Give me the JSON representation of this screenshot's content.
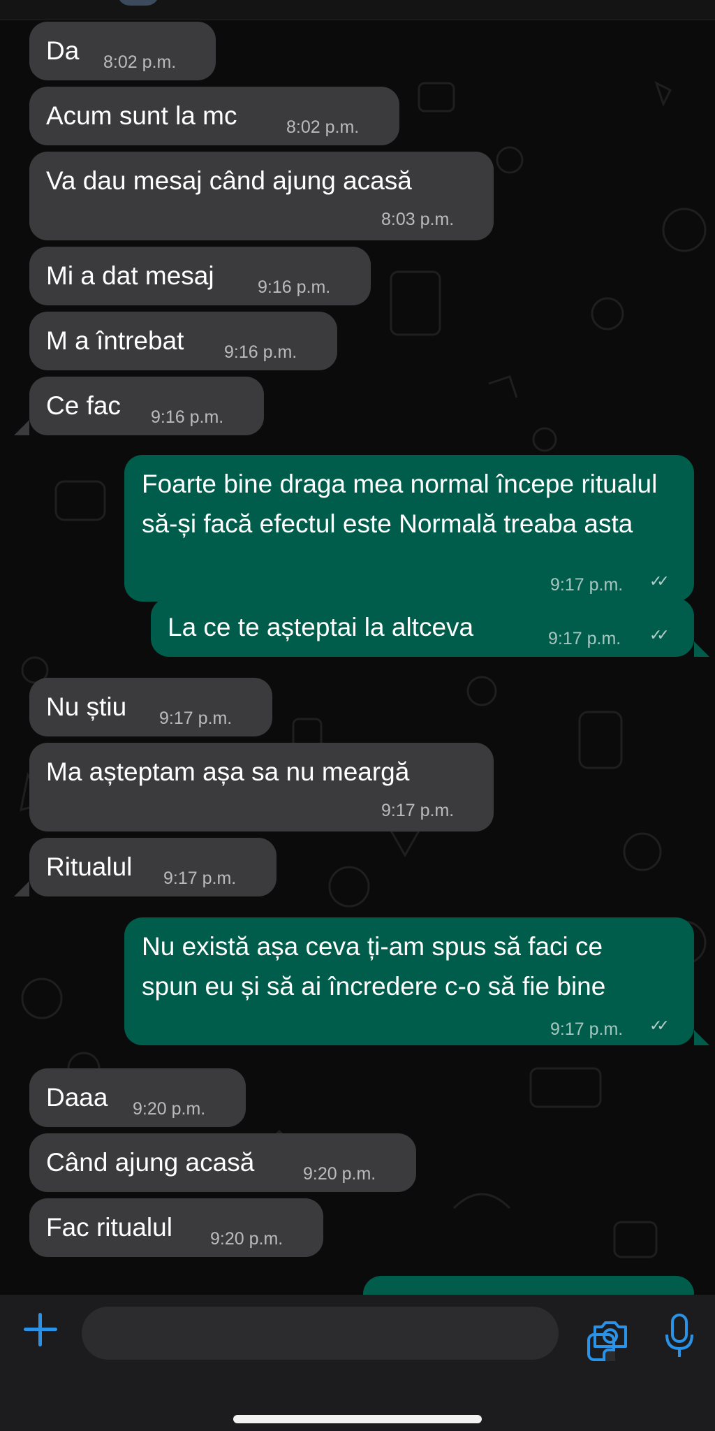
{
  "messages": [
    {
      "dir": "in",
      "text": "Da",
      "time": "8:02 p.m."
    },
    {
      "dir": "in",
      "text": "Acum sunt la mc",
      "time": "8:02 p.m."
    },
    {
      "dir": "in",
      "text": "Va dau mesaj când ajung acasă",
      "time": "8:03 p.m."
    },
    {
      "dir": "in",
      "text": "Mi a dat mesaj",
      "time": "9:16 p.m."
    },
    {
      "dir": "in",
      "text": "M a întrebat",
      "time": "9:16 p.m."
    },
    {
      "dir": "in",
      "text": "Ce fac",
      "time": "9:16 p.m."
    },
    {
      "dir": "out",
      "text": "Foarte bine draga mea normal începe ritualul să-și facă efectul este Normală treaba asta",
      "time": "9:17 p.m.",
      "status": "read"
    },
    {
      "dir": "out",
      "text": "La ce te așteptai la altceva",
      "time": "9:17 p.m.",
      "status": "read"
    },
    {
      "dir": "in",
      "text": "Nu știu",
      "time": "9:17 p.m."
    },
    {
      "dir": "in",
      "text": "Ma așteptam așa sa nu meargă",
      "time": "9:17 p.m."
    },
    {
      "dir": "in",
      "text": "Ritualul",
      "time": "9:17 p.m."
    },
    {
      "dir": "out",
      "text": "Nu există așa ceva ți-am spus să faci ce spun eu și să ai încredere c-o să fie bine",
      "time": "9:17 p.m.",
      "status": "read"
    },
    {
      "dir": "in",
      "text": "Daaa",
      "time": "9:20 p.m."
    },
    {
      "dir": "in",
      "text": "Când ajung acasă",
      "time": "9:20 p.m."
    },
    {
      "dir": "in",
      "text": "Fac ritualul",
      "time": "9:20 p.m."
    }
  ],
  "composer": {
    "placeholder": "",
    "icons": [
      "plus-icon",
      "sticker-icon",
      "camera-icon",
      "microphone-icon"
    ]
  },
  "colors": {
    "incoming_bubble": "#3b3b3d",
    "outgoing_bubble": "#005c4b",
    "accent": "#2a93e8",
    "background": "#0b0b0b"
  }
}
